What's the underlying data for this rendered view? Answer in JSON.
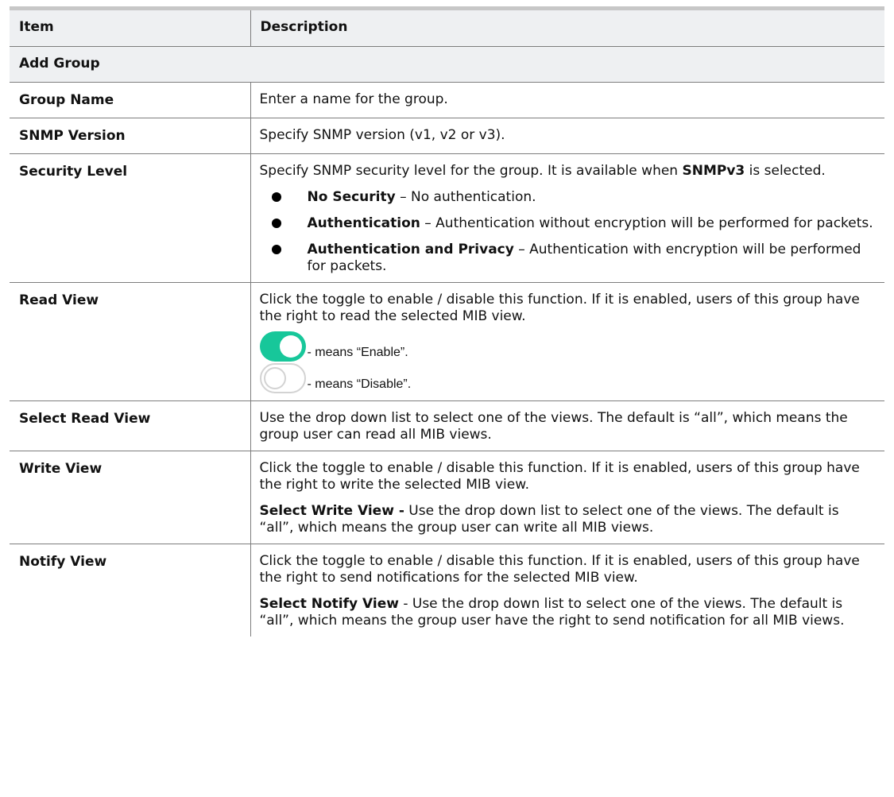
{
  "header": {
    "item": "Item",
    "description": "Description"
  },
  "section": "Add Group",
  "rows": {
    "group_name": {
      "item": "Group Name",
      "desc": "Enter a name for the group."
    },
    "snmp_version": {
      "item": "SNMP Version",
      "desc": "Specify SNMP version (v1, v2 or v3)."
    },
    "security_level": {
      "item": "Security Level",
      "desc_prefix": "Specify SNMP security level for the group. It is available when ",
      "desc_bold": "SNMPv3",
      "desc_suffix": " is selected.",
      "bullets": [
        {
          "term": "No Security",
          "text": " – No authentication."
        },
        {
          "term": "Authentication",
          "text": " – Authentication without encryption will be performed for packets."
        },
        {
          "term": "Authentication and Privacy",
          "text": " – Authentication with encryption will be performed for packets."
        }
      ]
    },
    "read_view": {
      "item": "Read View",
      "desc": "Click the toggle to enable / disable this function. If it is enabled, users of this group have the right to read the selected MIB view.",
      "toggle_on_text": "- means “Enable”.",
      "toggle_off_text": "- means “Disable”."
    },
    "select_read_view": {
      "item": "Select Read View",
      "desc": "Use the drop down list to select one of the views. The default is “all”, which means the group user can read all MIB views."
    },
    "write_view": {
      "item": "Write View",
      "desc": "Click the toggle to enable / disable this function. If it is enabled, users of this group have the right to write the selected MIB view.",
      "sub_bold": "Select Write View -",
      "sub_text": " Use the drop down list to select one of the views. The default is “all”, which means the group user can write all MIB views."
    },
    "notify_view": {
      "item": "Notify View",
      "desc": "Click the toggle to enable / disable this function. If it is enabled, users of this group have the right to send notifications for the selected MIB view.",
      "sub_bold": "Select Notify View",
      "sub_text": " - Use the drop down list to select one of the views. The default is “all”, which means the group user have the right to send notification for all MIB views."
    }
  },
  "colors": {
    "toggle_on": "#17c79a",
    "header_bg": "#eef0f2",
    "rule": "#7d7d7d"
  }
}
